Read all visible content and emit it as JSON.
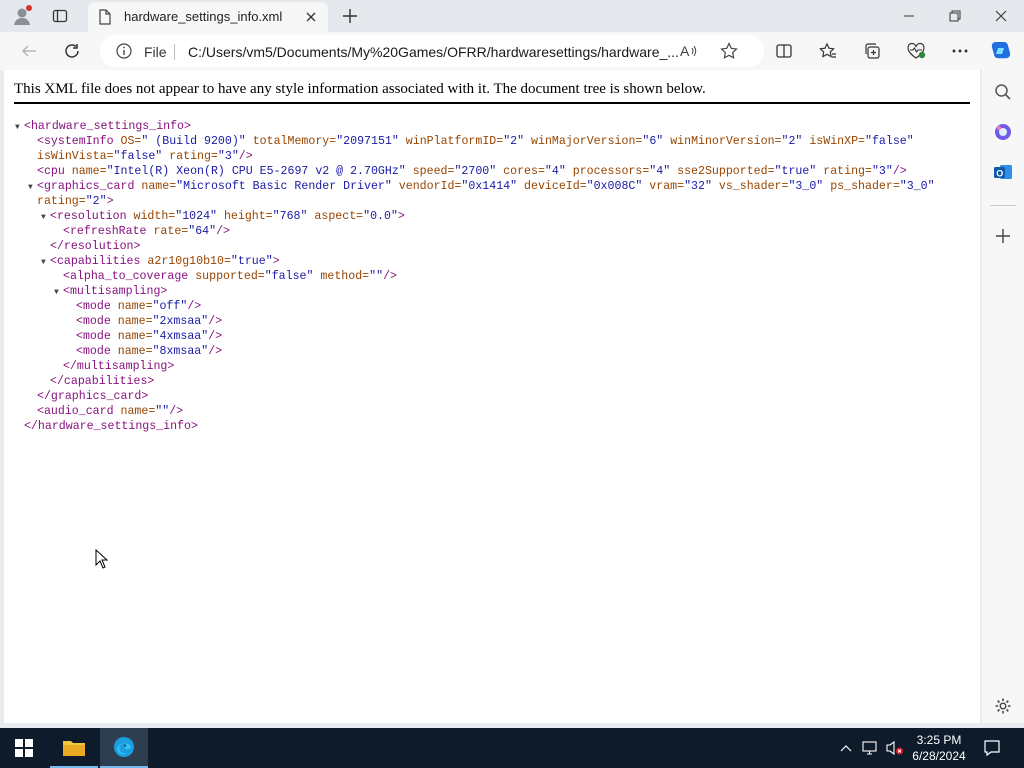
{
  "browser": {
    "tab_title": "hardware_settings_info.xml",
    "address": {
      "scheme_label": "File",
      "url": "C:/Users/vm5/Documents/My%20Games/OFRR/hardwaresettings/hardware_..."
    }
  },
  "page": {
    "notice": "This XML file does not appear to have any style information associated with it. The document tree is shown below.",
    "xml_lines": [
      {
        "indent": 0,
        "toggle": true,
        "parts": [
          {
            "t": "tg",
            "v": "<hardware_settings_info>"
          }
        ]
      },
      {
        "indent": 1,
        "toggle": false,
        "parts": [
          {
            "t": "tg",
            "v": "<systemInfo"
          },
          {
            "t": "an",
            "v": " OS="
          },
          {
            "t": "av",
            "v": "\" (Build 9200)\""
          },
          {
            "t": "an",
            "v": " totalMemory="
          },
          {
            "t": "av",
            "v": "\"2097151\""
          },
          {
            "t": "an",
            "v": " winPlatformID="
          },
          {
            "t": "av",
            "v": "\"2\""
          },
          {
            "t": "an",
            "v": " winMajorVersion="
          },
          {
            "t": "av",
            "v": "\"6\""
          },
          {
            "t": "an",
            "v": " winMinorVersion="
          },
          {
            "t": "av",
            "v": "\"2\""
          },
          {
            "t": "an",
            "v": " isWinXP="
          },
          {
            "t": "av",
            "v": "\"false\""
          }
        ]
      },
      {
        "indent": 1,
        "toggle": false,
        "parts": [
          {
            "t": "an",
            "v": "isWinVista="
          },
          {
            "t": "av",
            "v": "\"false\""
          },
          {
            "t": "an",
            "v": " rating="
          },
          {
            "t": "av",
            "v": "\"3\""
          },
          {
            "t": "tg",
            "v": "/>"
          }
        ]
      },
      {
        "indent": 1,
        "toggle": false,
        "parts": [
          {
            "t": "tg",
            "v": "<cpu"
          },
          {
            "t": "an",
            "v": " name="
          },
          {
            "t": "av",
            "v": "\"Intel(R) Xeon(R) CPU E5-2697 v2 @ 2.70GHz\""
          },
          {
            "t": "an",
            "v": " speed="
          },
          {
            "t": "av",
            "v": "\"2700\""
          },
          {
            "t": "an",
            "v": " cores="
          },
          {
            "t": "av",
            "v": "\"4\""
          },
          {
            "t": "an",
            "v": " processors="
          },
          {
            "t": "av",
            "v": "\"4\""
          },
          {
            "t": "an",
            "v": " sse2Supported="
          },
          {
            "t": "av",
            "v": "\"true\""
          },
          {
            "t": "an",
            "v": " rating="
          },
          {
            "t": "av",
            "v": "\"3\""
          },
          {
            "t": "tg",
            "v": "/>"
          }
        ]
      },
      {
        "indent": 1,
        "toggle": true,
        "parts": [
          {
            "t": "tg",
            "v": "<graphics_card"
          },
          {
            "t": "an",
            "v": " name="
          },
          {
            "t": "av",
            "v": "\"Microsoft Basic Render Driver\""
          },
          {
            "t": "an",
            "v": " vendorId="
          },
          {
            "t": "av",
            "v": "\"0x1414\""
          },
          {
            "t": "an",
            "v": " deviceId="
          },
          {
            "t": "av",
            "v": "\"0x008C\""
          },
          {
            "t": "an",
            "v": " vram="
          },
          {
            "t": "av",
            "v": "\"32\""
          },
          {
            "t": "an",
            "v": " vs_shader="
          },
          {
            "t": "av",
            "v": "\"3_0\""
          },
          {
            "t": "an",
            "v": " ps_shader="
          },
          {
            "t": "av",
            "v": "\"3_0\""
          }
        ]
      },
      {
        "indent": 1,
        "toggle": false,
        "parts": [
          {
            "t": "an",
            "v": "rating="
          },
          {
            "t": "av",
            "v": "\"2\""
          },
          {
            "t": "tg",
            "v": ">"
          }
        ]
      },
      {
        "indent": 2,
        "toggle": true,
        "parts": [
          {
            "t": "tg",
            "v": "<resolution"
          },
          {
            "t": "an",
            "v": " width="
          },
          {
            "t": "av",
            "v": "\"1024\""
          },
          {
            "t": "an",
            "v": " height="
          },
          {
            "t": "av",
            "v": "\"768\""
          },
          {
            "t": "an",
            "v": " aspect="
          },
          {
            "t": "av",
            "v": "\"0.0\""
          },
          {
            "t": "tg",
            "v": ">"
          }
        ]
      },
      {
        "indent": 3,
        "toggle": false,
        "parts": [
          {
            "t": "tg",
            "v": "<refreshRate"
          },
          {
            "t": "an",
            "v": " rate="
          },
          {
            "t": "av",
            "v": "\"64\""
          },
          {
            "t": "tg",
            "v": "/>"
          }
        ]
      },
      {
        "indent": 2,
        "toggle": false,
        "parts": [
          {
            "t": "tg",
            "v": "</resolution>"
          }
        ]
      },
      {
        "indent": 2,
        "toggle": true,
        "parts": [
          {
            "t": "tg",
            "v": "<capabilities"
          },
          {
            "t": "an",
            "v": " a2r10g10b10="
          },
          {
            "t": "av",
            "v": "\"true\""
          },
          {
            "t": "tg",
            "v": ">"
          }
        ]
      },
      {
        "indent": 3,
        "toggle": false,
        "parts": [
          {
            "t": "tg",
            "v": "<alpha_to_coverage"
          },
          {
            "t": "an",
            "v": " supported="
          },
          {
            "t": "av",
            "v": "\"false\""
          },
          {
            "t": "an",
            "v": " method="
          },
          {
            "t": "av",
            "v": "\"\""
          },
          {
            "t": "tg",
            "v": "/>"
          }
        ]
      },
      {
        "indent": 3,
        "toggle": true,
        "parts": [
          {
            "t": "tg",
            "v": "<multisampling>"
          }
        ]
      },
      {
        "indent": 4,
        "toggle": false,
        "parts": [
          {
            "t": "tg",
            "v": "<mode"
          },
          {
            "t": "an",
            "v": " name="
          },
          {
            "t": "av",
            "v": "\"off\""
          },
          {
            "t": "tg",
            "v": "/>"
          }
        ]
      },
      {
        "indent": 4,
        "toggle": false,
        "parts": [
          {
            "t": "tg",
            "v": "<mode"
          },
          {
            "t": "an",
            "v": " name="
          },
          {
            "t": "av",
            "v": "\"2xmsaa\""
          },
          {
            "t": "tg",
            "v": "/>"
          }
        ]
      },
      {
        "indent": 4,
        "toggle": false,
        "parts": [
          {
            "t": "tg",
            "v": "<mode"
          },
          {
            "t": "an",
            "v": " name="
          },
          {
            "t": "av",
            "v": "\"4xmsaa\""
          },
          {
            "t": "tg",
            "v": "/>"
          }
        ]
      },
      {
        "indent": 4,
        "toggle": false,
        "parts": [
          {
            "t": "tg",
            "v": "<mode"
          },
          {
            "t": "an",
            "v": " name="
          },
          {
            "t": "av",
            "v": "\"8xmsaa\""
          },
          {
            "t": "tg",
            "v": "/>"
          }
        ]
      },
      {
        "indent": 3,
        "toggle": false,
        "parts": [
          {
            "t": "tg",
            "v": "</multisampling>"
          }
        ]
      },
      {
        "indent": 2,
        "toggle": false,
        "parts": [
          {
            "t": "tg",
            "v": "</capabilities>"
          }
        ]
      },
      {
        "indent": 1,
        "toggle": false,
        "parts": [
          {
            "t": "tg",
            "v": "</graphics_card>"
          }
        ]
      },
      {
        "indent": 1,
        "toggle": false,
        "parts": [
          {
            "t": "tg",
            "v": "<audio_card"
          },
          {
            "t": "an",
            "v": " name="
          },
          {
            "t": "av",
            "v": "\"\""
          },
          {
            "t": "tg",
            "v": "/>"
          }
        ]
      },
      {
        "indent": 0,
        "toggle": false,
        "parts": [
          {
            "t": "tg",
            "v": "</hardware_settings_info>"
          }
        ]
      }
    ]
  },
  "taskbar": {
    "time": "3:25 PM",
    "date": "6/28/2024"
  },
  "colors": {
    "tag": "#881280",
    "attr_name": "#994500",
    "attr_value": "#1a1aa6",
    "taskbar_bg": "#0d1b2a",
    "copilot_accent": "#1f6fe0"
  }
}
